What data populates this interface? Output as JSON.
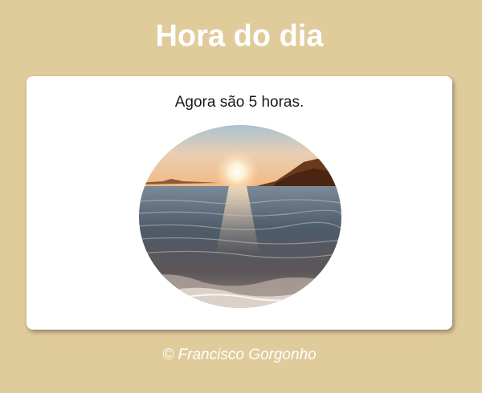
{
  "header": {
    "title": "Hora do dia"
  },
  "card": {
    "message": "Agora são 5 horas.",
    "image_subject": "sunset-over-sea"
  },
  "footer": {
    "credit": "© Francisco Gorgonho"
  },
  "colors": {
    "page_background": "#e0cb9b",
    "card_background": "#ffffff",
    "title_text": "#ffffff"
  }
}
